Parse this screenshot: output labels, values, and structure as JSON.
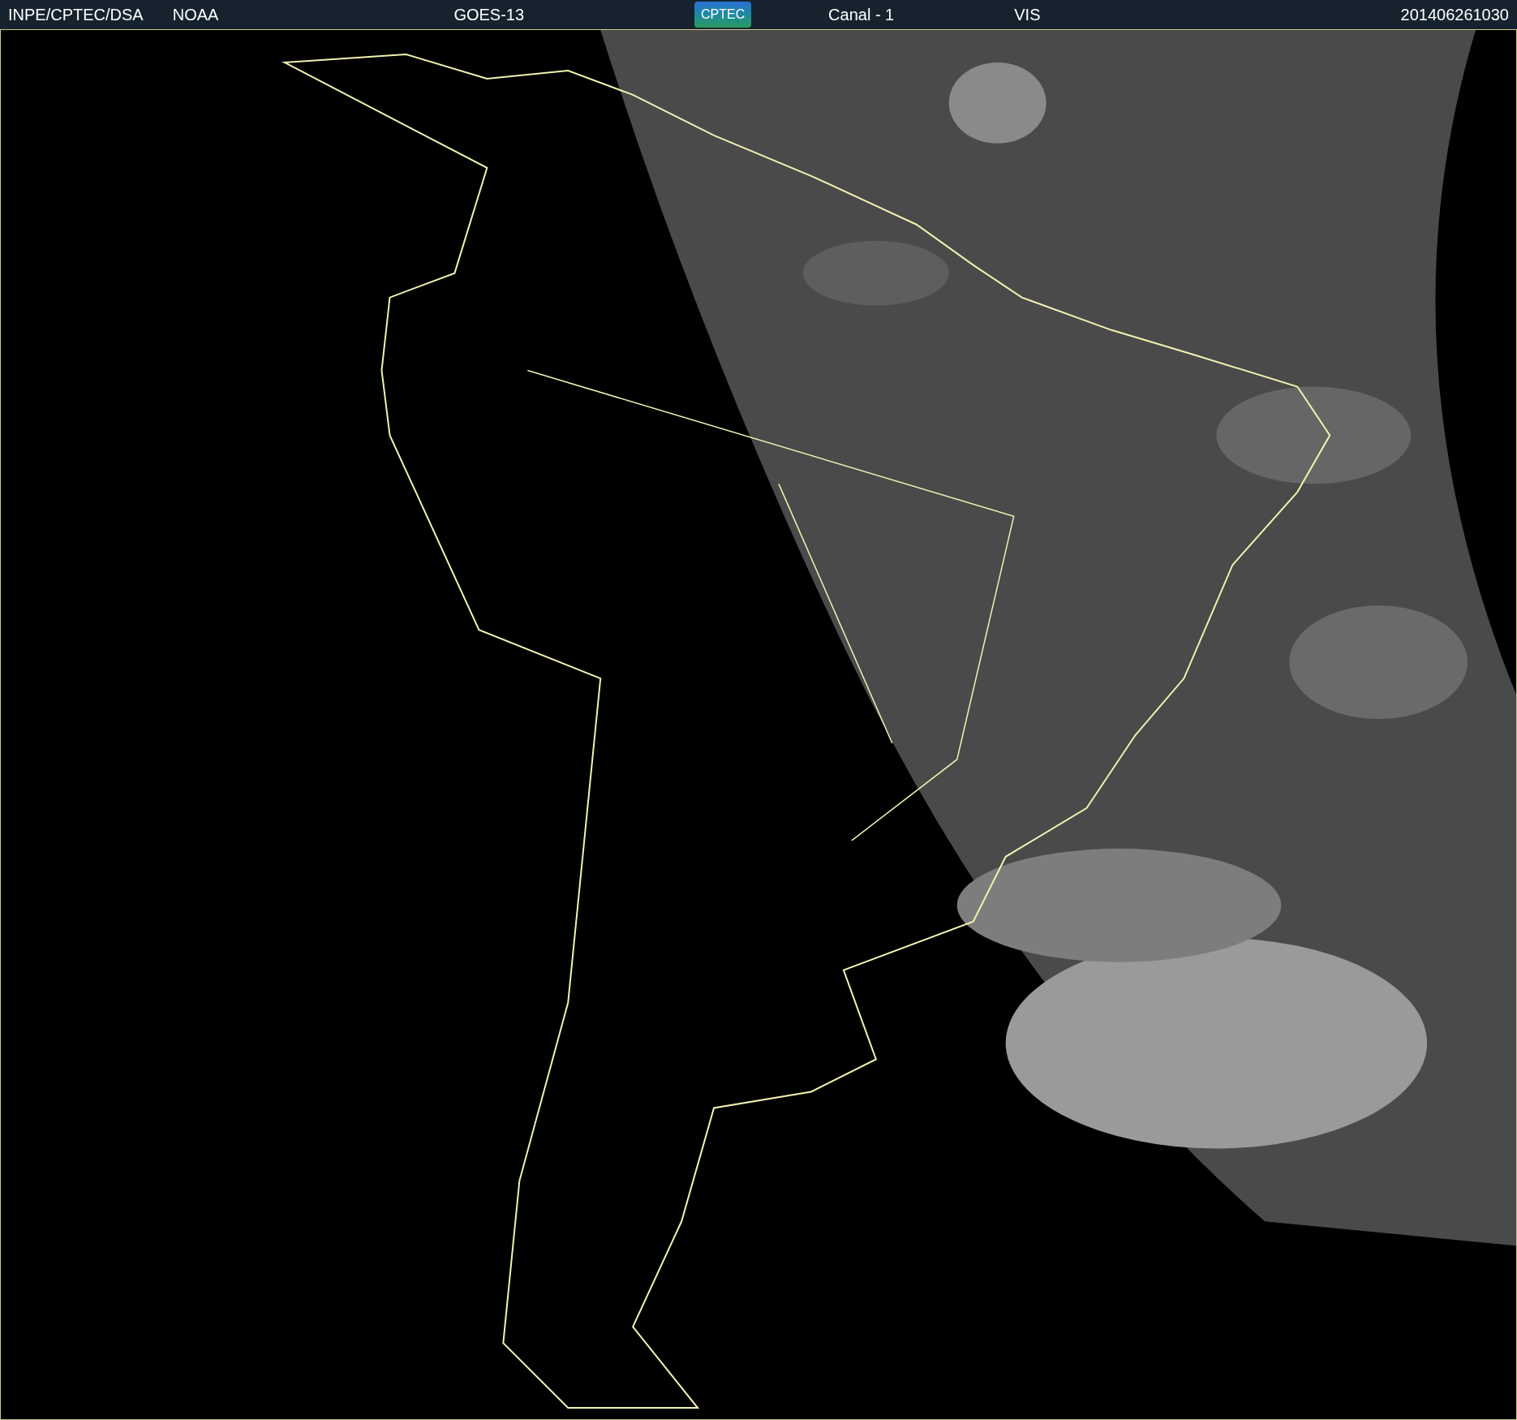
{
  "header": {
    "agency": "INPE/CPTEC/DSA",
    "source": "NOAA",
    "satellite": "GOES-13",
    "logo": "CPTEC",
    "channel": "Canal - 1",
    "band": "VIS",
    "timestamp": "201406261030"
  }
}
